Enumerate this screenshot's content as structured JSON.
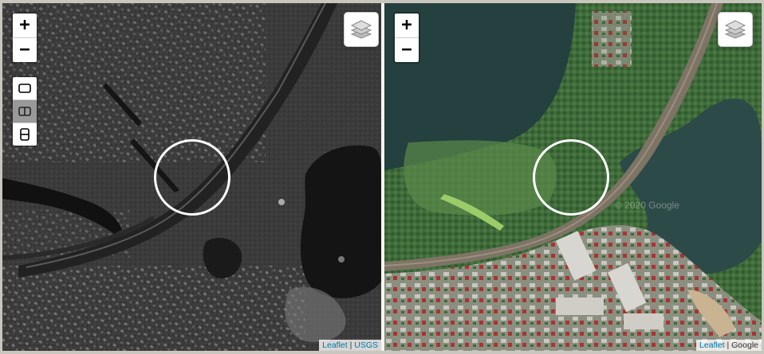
{
  "left_map": {
    "controls": {
      "zoom_in": "+",
      "zoom_out": "−"
    },
    "layers_icon": "layers-icon",
    "layout_modes": [
      "single-pane",
      "split-vertical",
      "split-horizontal"
    ],
    "attribution": {
      "leaflet": "Leaflet",
      "separator": " | ",
      "source": "USGS"
    }
  },
  "right_map": {
    "controls": {
      "zoom_in": "+",
      "zoom_out": "−"
    },
    "layers_icon": "layers-icon",
    "watermark": "© 2020 Google",
    "attribution": {
      "leaflet": "Leaflet",
      "separator": " | ",
      "source": "Google"
    }
  },
  "colors": {
    "divider": "#f4f4f2",
    "link": "#0078a8",
    "ring": "#ffffff"
  }
}
